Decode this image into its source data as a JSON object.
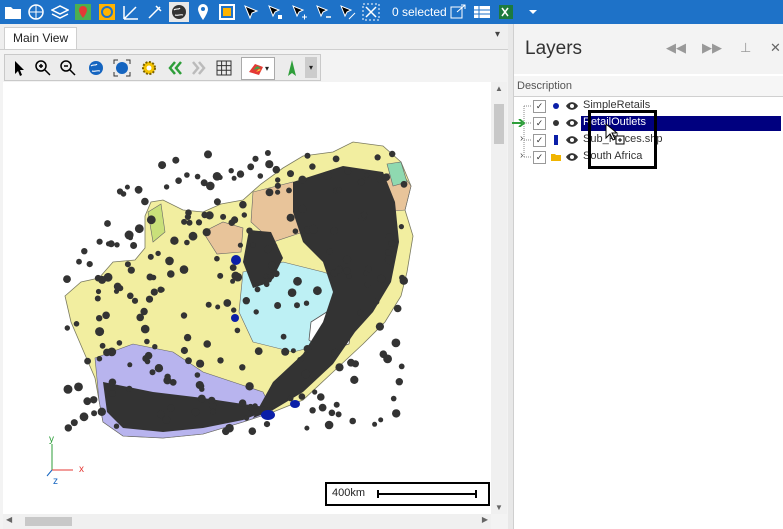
{
  "toolbar": {
    "icons": [
      "folder-icon",
      "globe-settings-icon",
      "layers-icon",
      "map-pin-icon",
      "select-frame-icon",
      "measure-icon",
      "pen-icon",
      "world-icon",
      "location-icon",
      "frame-icon",
      "select-tool-icon",
      "node-tool-icon",
      "node-add-icon",
      "node-remove-icon",
      "node-split-icon",
      "clear-selection-icon"
    ],
    "selection_text": "0 selected",
    "right_icons": [
      "zoom-selection-icon",
      "attribute-table-icon",
      "excel-export-icon",
      "dropdown-icon"
    ]
  },
  "map_view": {
    "tab_label": "Main View",
    "tools": [
      "pointer-icon",
      "zoom-in-icon",
      "zoom-out-icon",
      "zoom-world-icon",
      "zoom-extent-icon",
      "settings-gear-icon",
      "back-icon",
      "forward-icon",
      "grid-icon",
      "color-theme-icon",
      "north-arrow-icon"
    ],
    "scale_label": "400km",
    "axis_x": "x",
    "axis_y": "y",
    "axis_z": "z"
  },
  "layers_panel": {
    "title": "Layers",
    "column_header": "Description",
    "layers": [
      {
        "name": "SimpleRetails",
        "checked": true,
        "selected": false
      },
      {
        "name": "RetailOutlets",
        "checked": true,
        "selected": true
      },
      {
        "name": "Sub_Places.shp",
        "checked": true,
        "selected": false
      },
      {
        "name": "South Africa",
        "checked": true,
        "selected": false
      }
    ]
  },
  "colors": {
    "toolbar_bg": "#1e72c8",
    "selection_bg": "#00007f",
    "outlet_dots": "#333333",
    "region_yellow": "#f2eea0",
    "region_purple": "#b8b4ee",
    "region_cyan": "#bdf0f4",
    "region_tan": "#e8c49a"
  }
}
